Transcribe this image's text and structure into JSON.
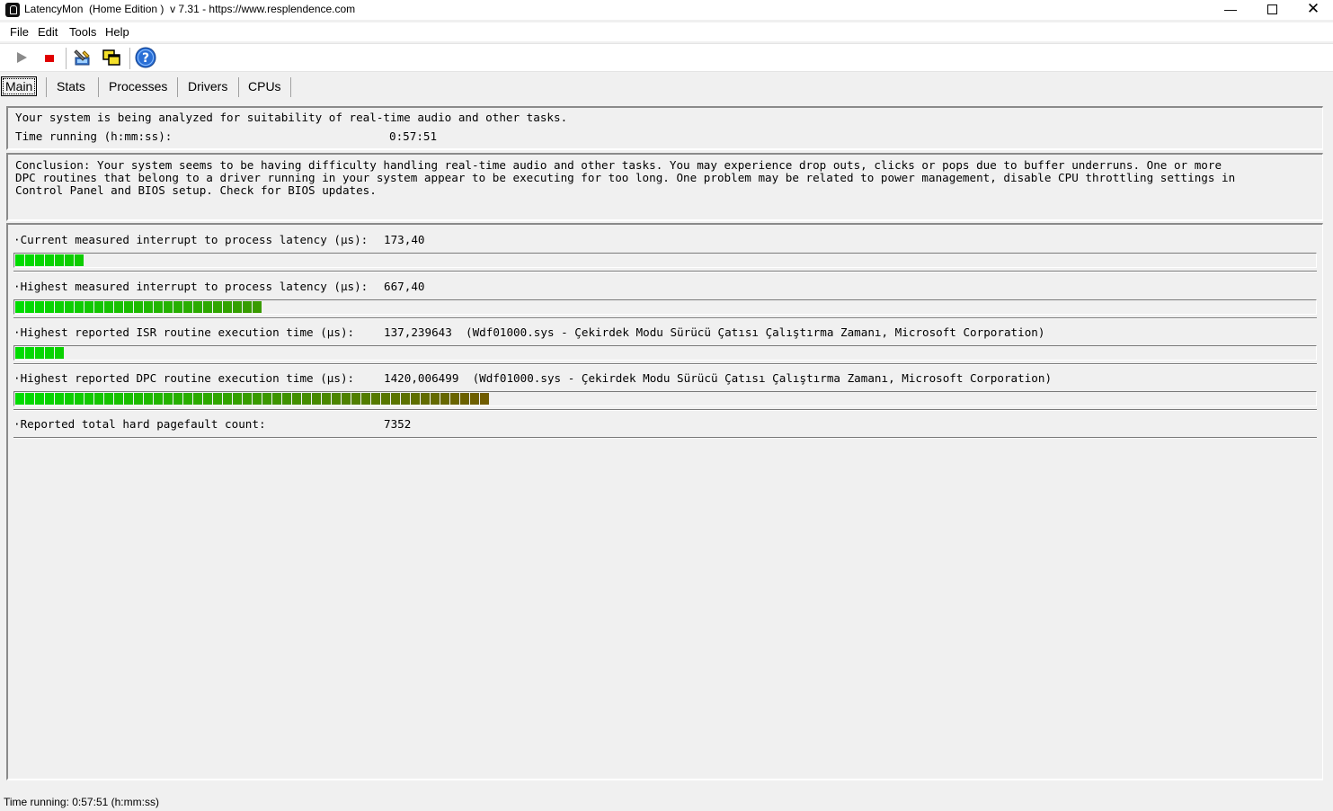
{
  "window": {
    "title": "LatencyMon  (Home Edition )  v 7.31 - https://www.resplendence.com",
    "controls": {
      "minimize": "—",
      "close": "✕"
    }
  },
  "menu": {
    "file": "File",
    "edit": "Edit",
    "tools": "Tools",
    "help": "Help"
  },
  "toolbar": {
    "icons": [
      "play-icon",
      "stop-icon",
      "tools-icon",
      "windows-icon",
      "help-icon"
    ],
    "stop_color": "#e00000"
  },
  "tabs": [
    {
      "label": "Main",
      "selected": true
    },
    {
      "label": "Stats"
    },
    {
      "label": "Processes"
    },
    {
      "label": "Drivers"
    },
    {
      "label": "CPUs"
    }
  ],
  "status_panel": {
    "line1": "Your system is being analyzed for suitability of real-time audio and other tasks.",
    "time_label": "Time running (h:mm:ss):",
    "time_value": "0:57:51"
  },
  "conclusion": {
    "line1": "Conclusion: Your system seems to be having difficulty handling real-time audio and other tasks. You may experience drop outs, clicks or pops due to buffer underruns. One or more",
    "line2": "DPC routines that belong to a driver running in your system appear to be executing for too long. One problem may be related to power management, disable CPU throttling settings in",
    "line3": "Control Panel and BIOS setup. Check for BIOS updates."
  },
  "metrics": [
    {
      "label": "·Current measured interrupt to process latency (µs):",
      "value": "173,40",
      "segments": 7,
      "bar": true
    },
    {
      "label": "·Highest measured interrupt to process latency (µs):",
      "value": "667,40",
      "segments": 25,
      "bar": true
    },
    {
      "label": "·Highest reported ISR routine execution time (µs):",
      "value": "137,239643  (Wdf01000.sys - Çekirdek Modu Sürücü Çatısı Çalıştırma Zamanı, Microsoft Corporation)",
      "segments": 5,
      "bar": true
    },
    {
      "label": "·Highest reported DPC routine execution time (µs):",
      "value": "1420,006499  (Wdf01000.sys - Çekirdek Modu Sürücü Çatısı Çalıştırma Zamanı, Microsoft Corporation)",
      "segments": 48,
      "bar": true
    },
    {
      "label": "·Reported total hard pagefault count:",
      "value": "7352",
      "bar": false
    }
  ],
  "statusbar": {
    "text": "Time running: 0:57:51  (h:mm:ss)"
  }
}
